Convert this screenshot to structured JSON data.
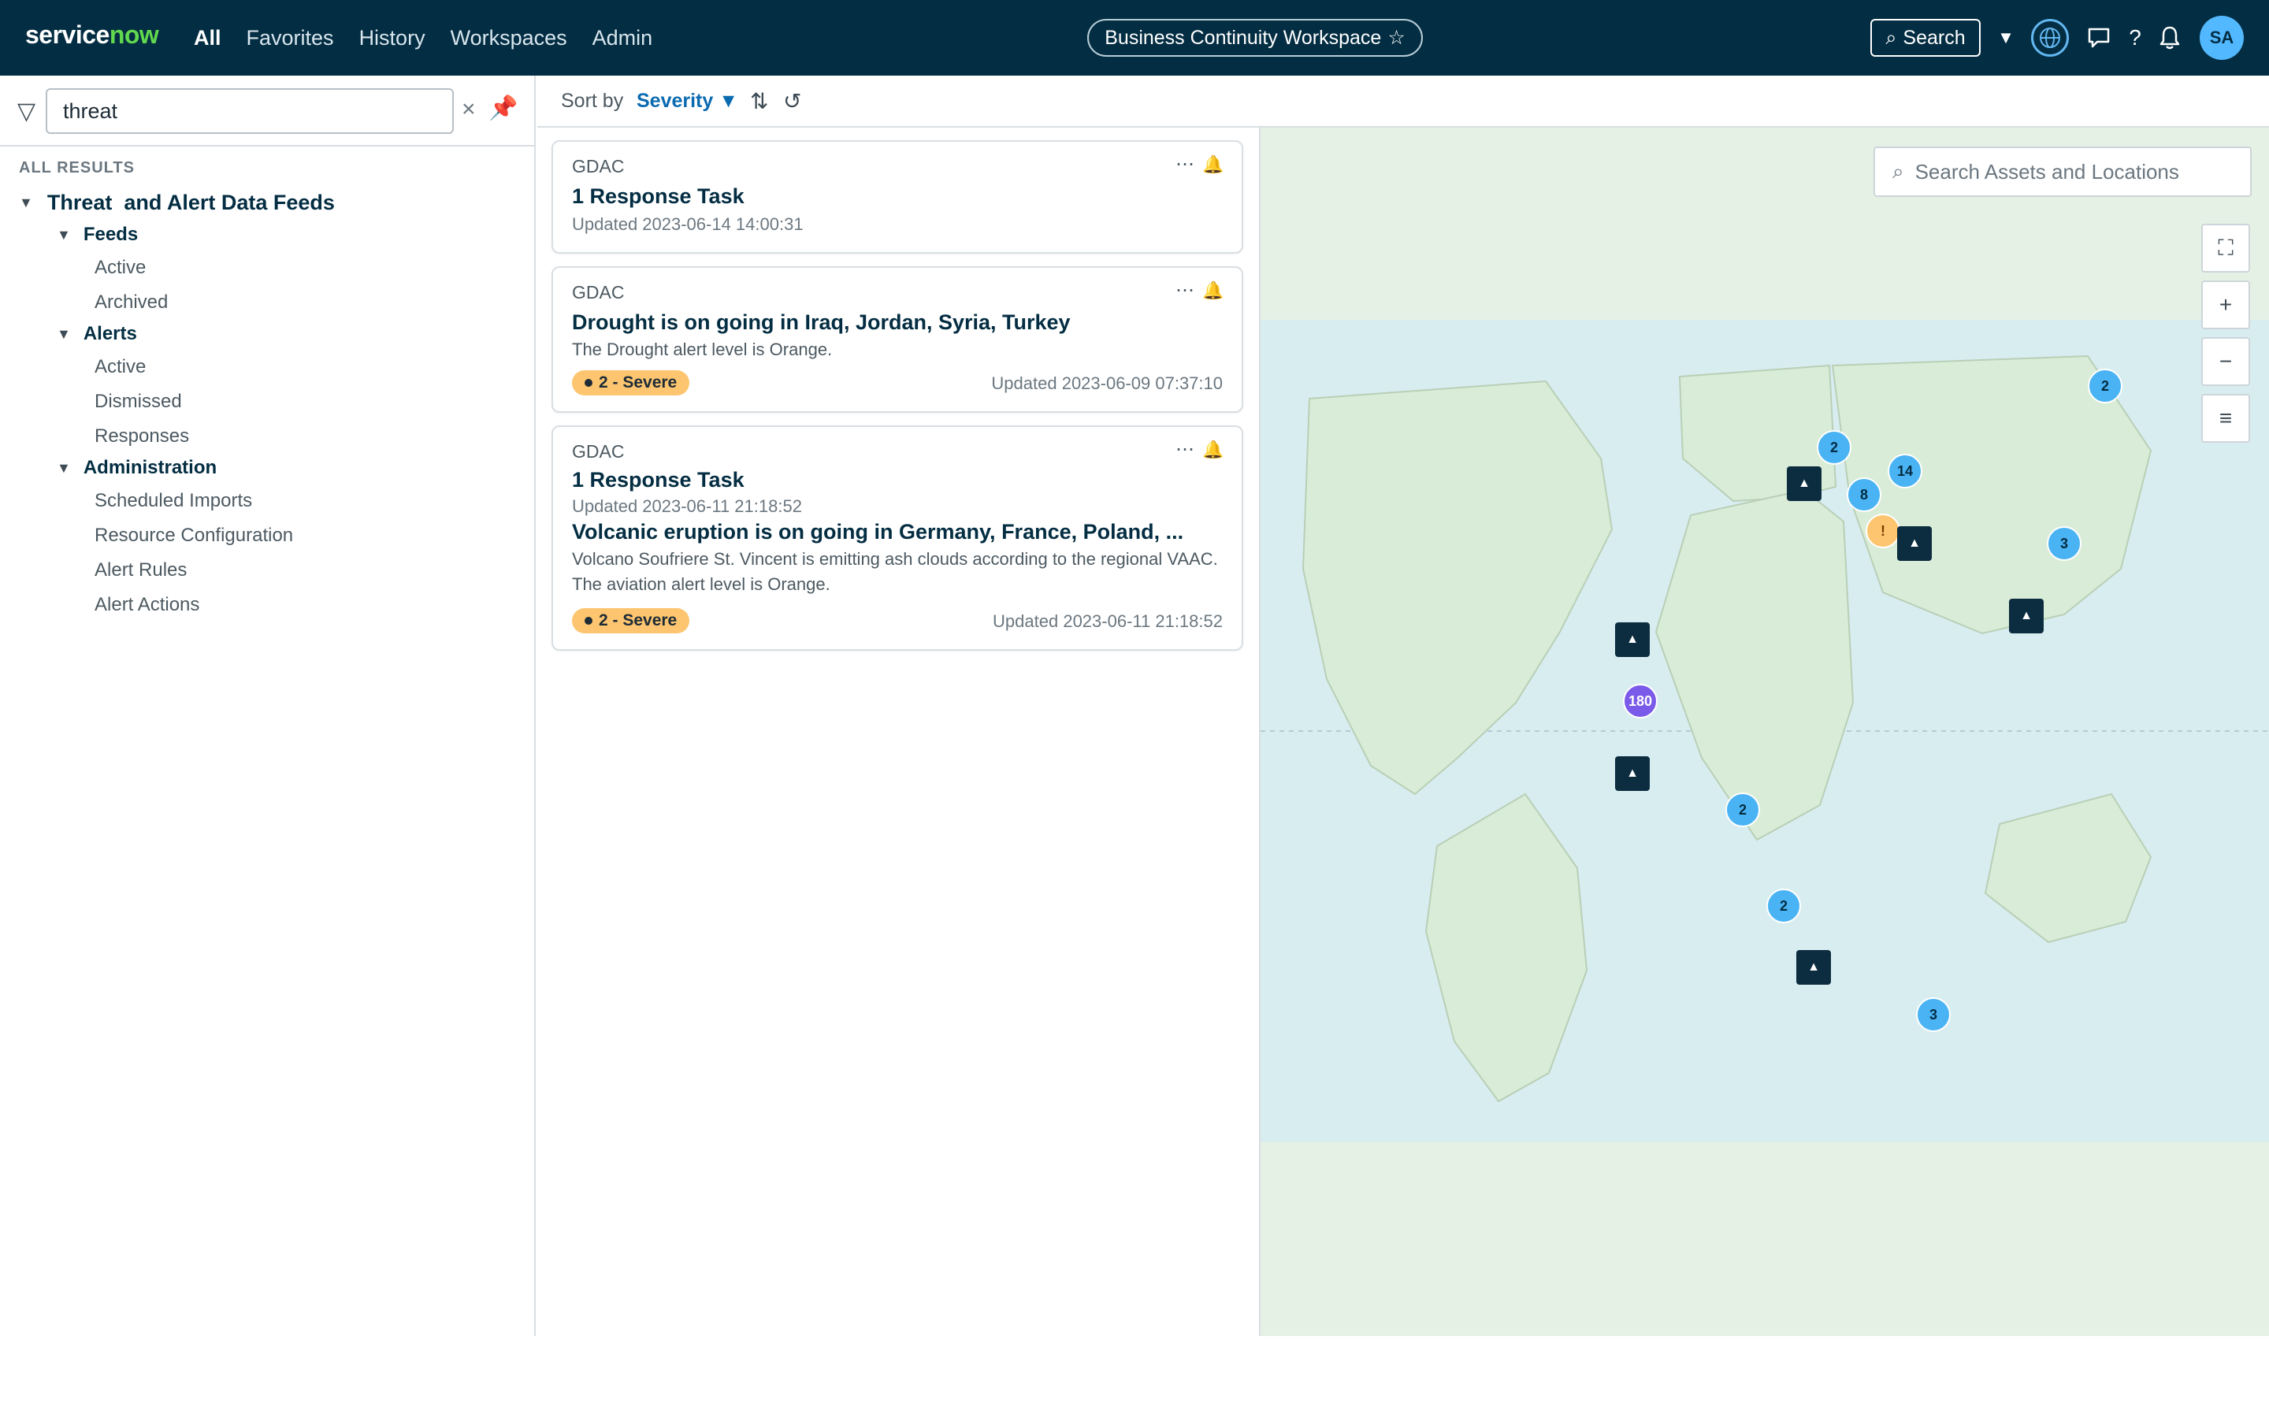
{
  "topnav": {
    "logo_main": "service",
    "logo_accent": "now",
    "links": [
      "All",
      "Favorites",
      "History",
      "Workspaces",
      "Admin"
    ],
    "workspace": "Business Continuity Workspace",
    "workspace_star": "☆",
    "search_label": "Search",
    "user_initials": "SA",
    "brand_color": "#032d42",
    "accent_color": "#62d84e"
  },
  "sidebar": {
    "filter_value": "threat",
    "section_label": "ALL RESULTS",
    "root": "Threat  and Alert Data Feeds",
    "groups": [
      {
        "label": "Feeds",
        "items": [
          "Active",
          "Archived"
        ]
      },
      {
        "label": "Alerts",
        "items": [
          "Active",
          "Dismissed",
          "Responses"
        ]
      },
      {
        "label": "Administration",
        "items": [
          "Scheduled Imports",
          "Resource Configuration",
          "Alert Rules",
          "Alert Actions"
        ]
      }
    ]
  },
  "sortbar": {
    "label": "Sort by",
    "value": "Severity"
  },
  "cards": [
    {
      "source": "GDAC",
      "title": "1 Response Task",
      "updated": "Updated 2023-06-14 14:00:31"
    },
    {
      "source": "GDAC",
      "title": "Drought is on going in Iraq, Jordan, Syria, Turkey",
      "description": "The Drought alert level is Orange.",
      "badge": "2 - Severe",
      "updated": "Updated 2023-06-09 07:37:10"
    },
    {
      "source": "GDAC",
      "title": "1 Response Task",
      "task_updated": "Updated 2023-06-11 21:18:52",
      "title2": "Volcanic eruption is on going in Germany, France, Poland, ...",
      "description": "Volcano Soufriere St. Vincent is emitting ash clouds according to the regional VAAC. The aviation alert level is Orange.",
      "badge": "2 - Severe",
      "updated": "Updated 2023-06-11 21:18:52"
    }
  ],
  "map": {
    "search_placeholder": "Search Assets and Locations",
    "clusters": [
      "2",
      "2",
      "14",
      "8",
      "3",
      "180",
      "2",
      "2",
      "3"
    ],
    "warning_label": "!",
    "icons": [
      "fullscreen-icon",
      "zoom-in-icon",
      "zoom-out-icon",
      "layers-icon"
    ],
    "severity_color": "#fdc56f"
  }
}
